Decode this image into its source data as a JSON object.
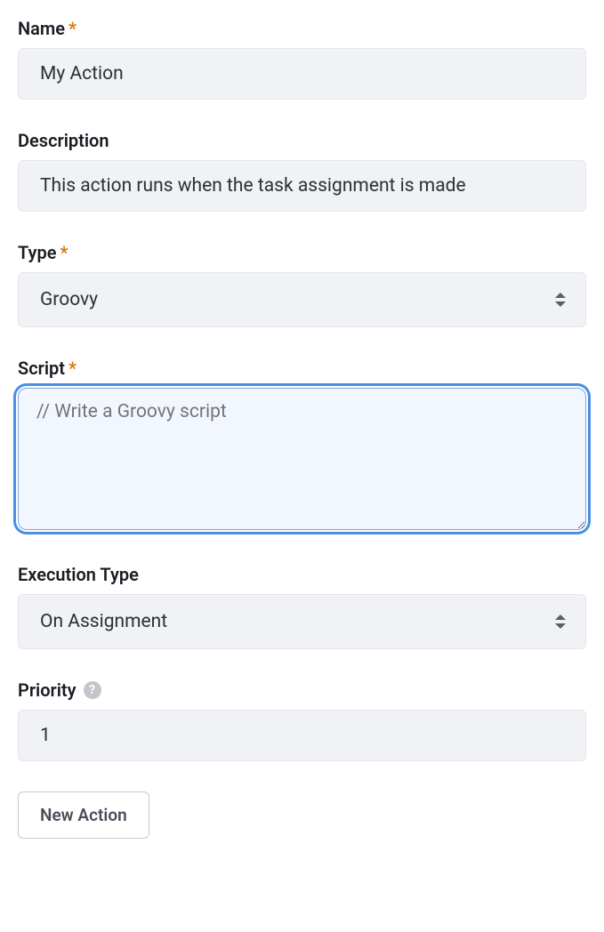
{
  "fields": {
    "name": {
      "label": "Name",
      "required": true,
      "value": "My Action"
    },
    "description": {
      "label": "Description",
      "required": false,
      "value": "This action runs when the task assignment is made"
    },
    "type": {
      "label": "Type",
      "required": true,
      "value": "Groovy"
    },
    "script": {
      "label": "Script",
      "required": true,
      "placeholder": "// Write a Groovy script"
    },
    "executionType": {
      "label": "Execution Type",
      "required": false,
      "value": "On Assignment"
    },
    "priority": {
      "label": "Priority",
      "required": false,
      "hasHelp": true,
      "value": "1"
    }
  },
  "buttons": {
    "newAction": "New Action"
  },
  "requiredMarker": "*",
  "helpMarker": "?"
}
